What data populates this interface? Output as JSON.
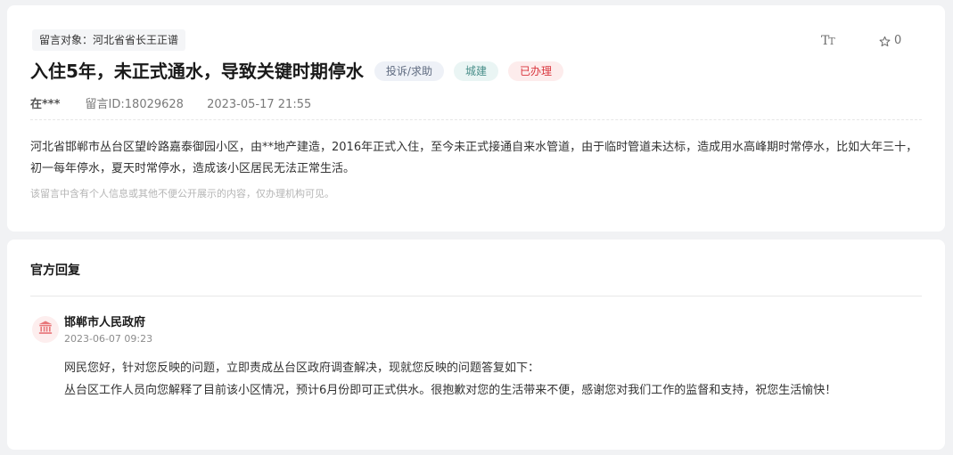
{
  "message": {
    "target_tag": "留言对象：河北省省长王正谱",
    "font_size_label": "T",
    "font_size_label_small": "T",
    "like_count": "0",
    "title": "入住5年，未正式通水，导致关键时期停水",
    "badges": {
      "type": "投诉/求助",
      "domain": "城建",
      "status": "已办理"
    },
    "author": "在***",
    "message_id": "留言ID:18029628",
    "datetime": "2023-05-17 21:55",
    "body": "河北省邯郸市丛台区望岭路嘉泰御园小区，由**地产建造，2016年正式入住，至今未正式接通自来水管道，由于临时管道未达标，造成用水高峰期时常停水，比如大年三十，初一每年停水，夏天时常停水，造成该小区居民无法正常生活。",
    "privacy_note": "该留言中含有个人信息或其他不便公开展示的内容，仅办理机构可见。"
  },
  "reply": {
    "heading": "官方回复",
    "organization": "邯郸市人民政府",
    "datetime": "2023-06-07 09:23",
    "lines": [
      "网民您好，针对您反映的问题，立即责成丛台区政府调查解决，现就您反映的问题答复如下：",
      "丛台区工作人员向您解释了目前该小区情况，预计6月份即可正式供水。很抱歉对您的生活带来不便，感谢您对我们工作的监督和支持，祝您生活愉快！"
    ]
  },
  "colors": {
    "page_background": "#f1f2f4",
    "card_background": "#ffffff",
    "status_red": "#d9363e",
    "domain_teal": "#4a8f8a",
    "type_gray_blue": "#5f6b80",
    "gov_icon_red": "#e8777a"
  },
  "icons": {
    "font_size": "font-size-icon",
    "like": "star-icon",
    "organization": "government-building-icon"
  }
}
